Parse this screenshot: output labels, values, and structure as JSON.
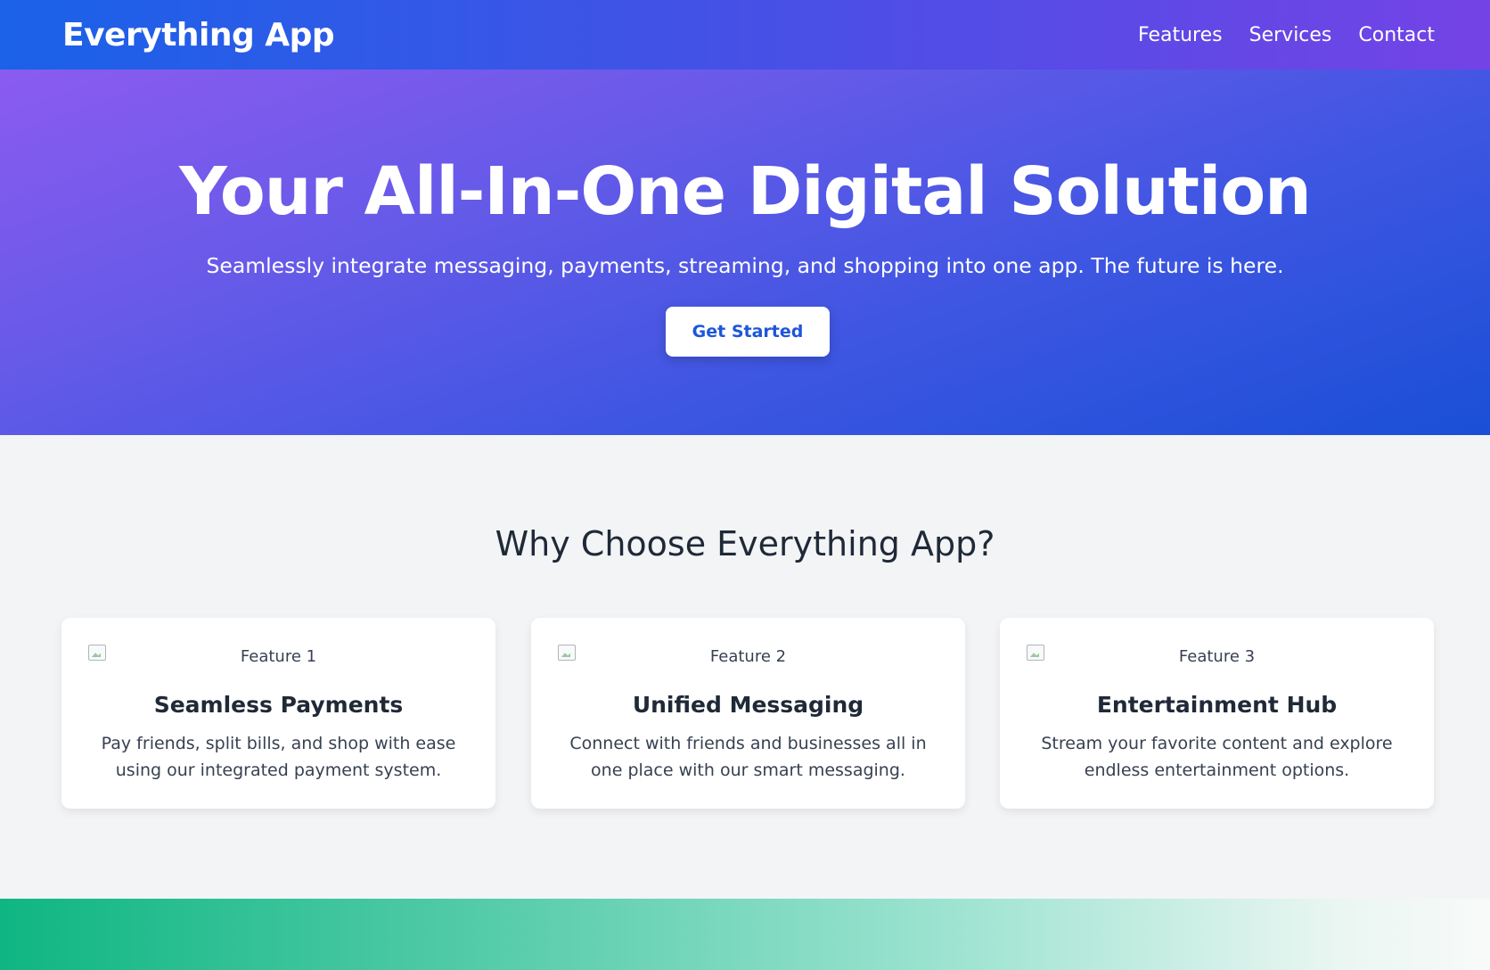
{
  "navbar": {
    "brand": "Everything App",
    "links": [
      "Features",
      "Services",
      "Contact"
    ]
  },
  "hero": {
    "title": "Your All-In-One Digital Solution",
    "subtitle": "Seamlessly integrate messaging, payments, streaming, and shopping into one app. The future is here.",
    "cta_label": "Get Started"
  },
  "features": {
    "title": "Why Choose Everything App?",
    "cards": [
      {
        "image_alt": "Feature 1",
        "title": "Seamless Payments",
        "description": "Pay friends, split bills, and shop with ease using our integrated payment system."
      },
      {
        "image_alt": "Feature 2",
        "title": "Unified Messaging",
        "description": "Connect with friends and businesses all in one place with our smart messaging."
      },
      {
        "image_alt": "Feature 3",
        "title": "Entertainment Hub",
        "description": "Stream your favorite content and explore endless entertainment options."
      }
    ]
  },
  "colors": {
    "nav_gradient_start": "#1a62e8",
    "nav_gradient_end": "#7443e6",
    "hero_gradient_start": "#8b5bf0",
    "hero_gradient_end": "#1a4fd6",
    "cta_text": "#1e56d9",
    "footer_gradient_start": "#0fb682"
  }
}
